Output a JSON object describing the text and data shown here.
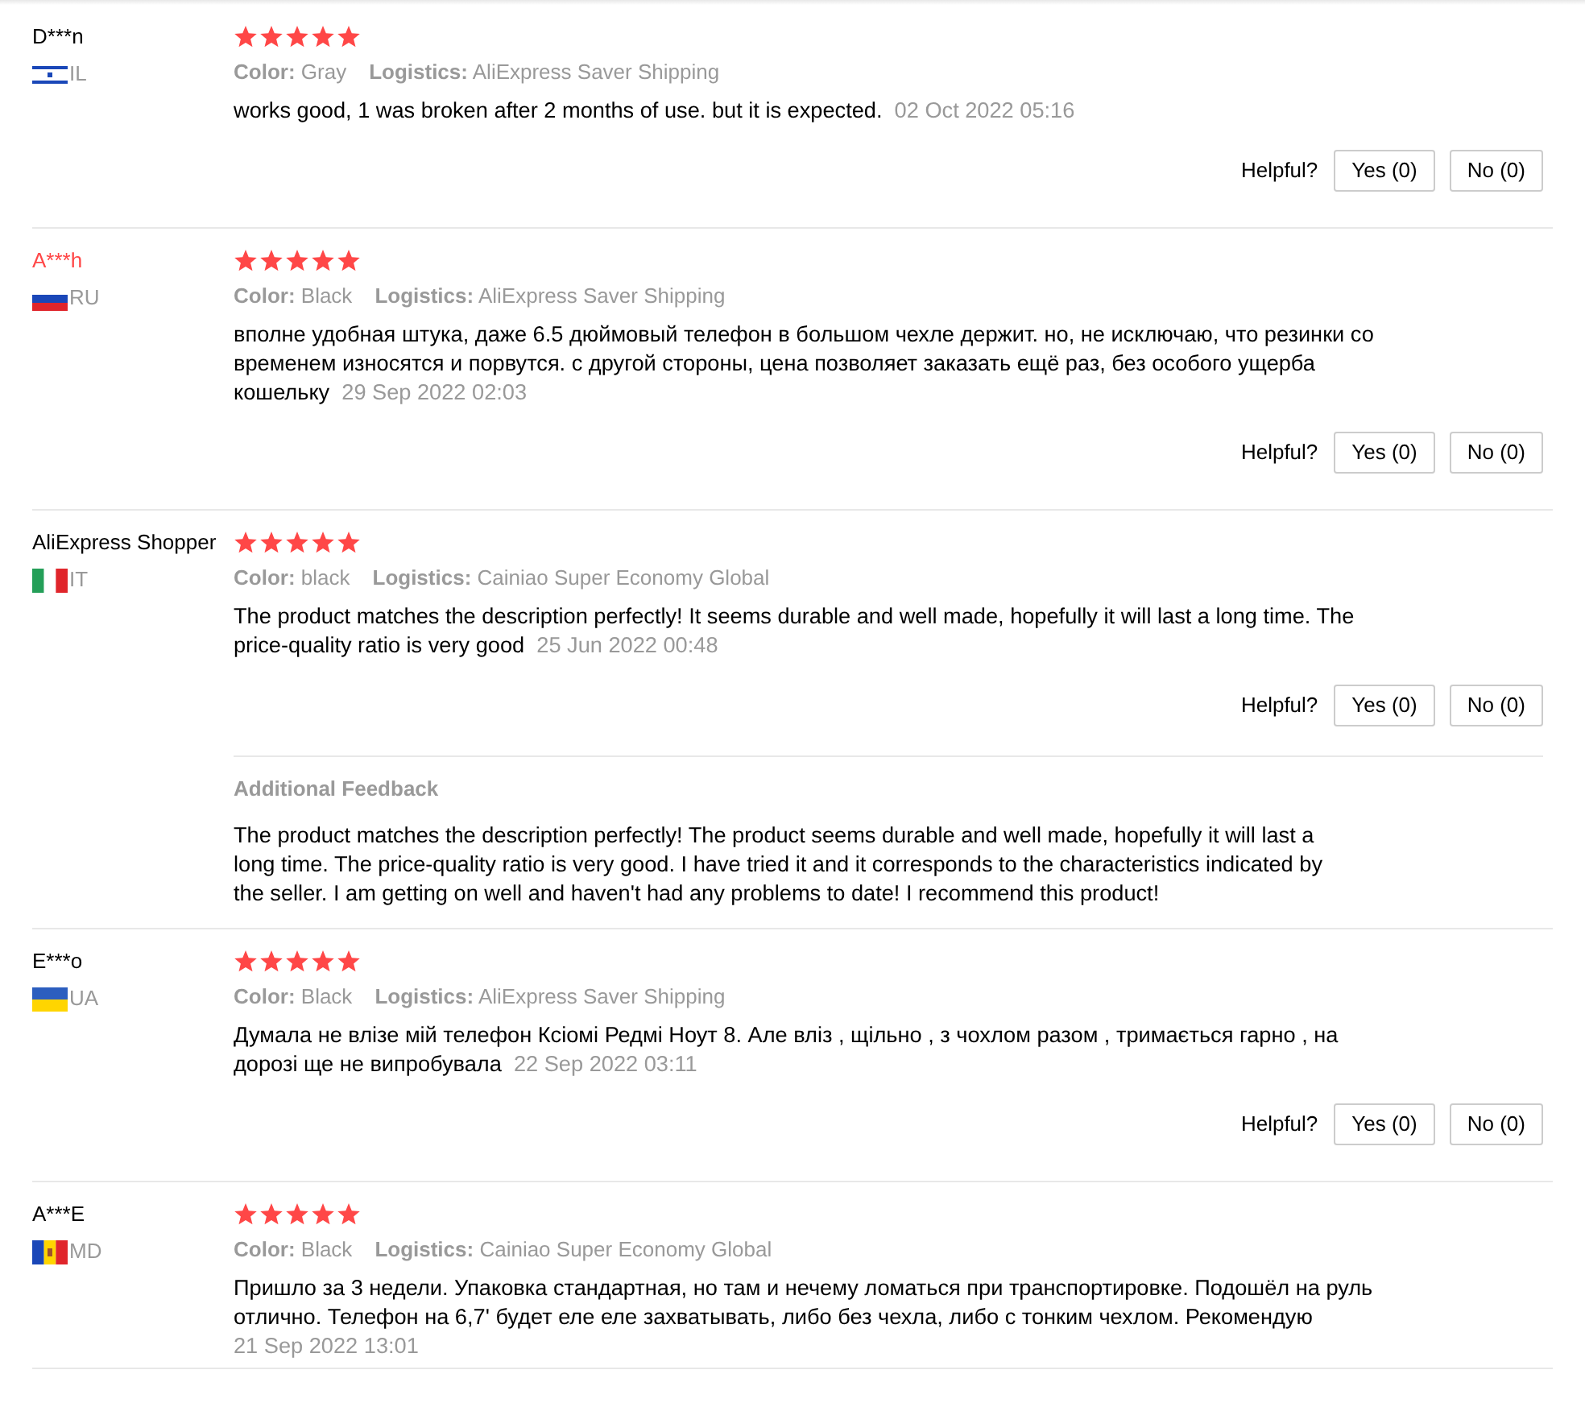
{
  "reviews": [
    {
      "name": "D***n",
      "color": "#000000",
      "kind": "il",
      "country": "IL",
      "stars": 5,
      "color_label": "Color:",
      "color_value": "Gray",
      "logistics_label": "Logistics:",
      "logistics_value": "AliExpress Saver Shipping",
      "comment": "works good, 1 was broken after 2 months of use. but it is expected.",
      "date": "02 Oct 2022 05:16",
      "helpful": {
        "label": "Helpful?",
        "yes": "Yes (0)",
        "no": "No (0)"
      }
    },
    {
      "name": "A***h",
      "color": "#ff4747",
      "kind": "ru",
      "country": "RU",
      "stars": 5,
      "color_label": "Color:",
      "color_value": "Black",
      "logistics_label": "Logistics:",
      "logistics_value": "AliExpress Saver Shipping",
      "comment": "вполне удобная штука, даже 6.5 дюймовый телефон в большом чехле держит. но, не исключаю, что резинки со временем износятся и порвутся. с другой стороны, цена позволяет заказать ещё раз, без особого ущерба кошельку",
      "date": "29 Sep 2022 02:03",
      "helpful": {
        "label": "Helpful?",
        "yes": "Yes (0)",
        "no": "No (0)"
      }
    },
    {
      "name": "AliExpress Shopper",
      "color": "#000000",
      "kind": "it",
      "country": "IT",
      "stars": 5,
      "color_label": "Color:",
      "color_value": "black",
      "logistics_label": "Logistics:",
      "logistics_value": "Cainiao Super Economy Global",
      "comment": "The product matches the description perfectly! It seems durable and well made, hopefully it will last a long time. The price-quality ratio is very good",
      "date": "25 Jun 2022 00:48",
      "helpful": {
        "label": "Helpful?",
        "yes": "Yes (0)",
        "no": "No (0)"
      },
      "additional": {
        "title": "Additional Feedback",
        "text": "The product matches the description perfectly! The product seems durable and well made, hopefully it will last a long time. The price-quality ratio is very good. I have tried it and it corresponds to the characteristics indicated by the seller. I am getting on well and haven't had any problems to date! I recommend this product!"
      }
    },
    {
      "name": "E***o",
      "color": "#000000",
      "kind": "ua",
      "country": "UA",
      "stars": 5,
      "color_label": "Color:",
      "color_value": "Black",
      "logistics_label": "Logistics:",
      "logistics_value": "AliExpress Saver Shipping",
      "comment": "Думала не влізе мій телефон Ксіомі Редмі Ноут 8. Але вліз , щільно , з чохлом разом , тримається гарно , на дорозі ще не випробувала",
      "date": "22 Sep 2022 03:11",
      "helpful": {
        "label": "Helpful?",
        "yes": "Yes (0)",
        "no": "No (0)"
      }
    },
    {
      "name": "A***E",
      "color": "#000000",
      "kind": "md",
      "country": "MD",
      "stars": 5,
      "color_label": "Color:",
      "color_value": "Black",
      "logistics_label": "Logistics:",
      "logistics_value": "Cainiao Super Economy Global",
      "comment": "Пришло за 3 недели. Упаковка стандартная, но там и нечему ломаться при транспортировке. Подошёл на руль отлично. Телефон на 6,7' будет еле еле захватывать, либо без чехла, либо с тонким чехлом. Рекомендую",
      "date": "21 Sep 2022 13:01"
    }
  ]
}
